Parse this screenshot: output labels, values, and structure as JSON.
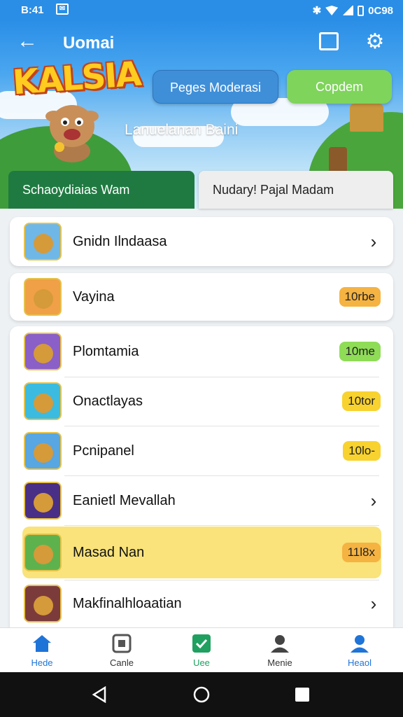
{
  "status_bar": {
    "time": "B:41",
    "mail_icon": "mail-icon",
    "battery": "0C98"
  },
  "app_bar": {
    "title": "Uomai"
  },
  "hero": {
    "logo_text": "KALSIA",
    "subtitle": "Lanuelanan Baini",
    "buttons": {
      "moderasi": "Peges Moderasi",
      "copy": "Copdem"
    },
    "colors": {
      "sky": "#2b8fe7",
      "grass": "#3f9c3a",
      "logo": "#ffcc1f"
    }
  },
  "tabs": {
    "left": "Schaoydiaias Wam",
    "right": "Nudary! Pajal Madam"
  },
  "items": [
    {
      "label": "Gnidn Ilndaasa",
      "trailing": "chevron",
      "thumb_color": "#6fb7e6"
    },
    {
      "label": "Vayina",
      "badge": "10rbe",
      "badge_color": "orange",
      "thumb_color": "#f0a046"
    },
    {
      "label": "Plomtamia",
      "badge": "10me",
      "badge_color": "green",
      "thumb_color": "#8a5fc7"
    },
    {
      "label": "Onactlayas",
      "badge": "10tor",
      "badge_color": "yellow",
      "thumb_color": "#3bbbe0"
    },
    {
      "label": "Pcnipanel",
      "badge": "10lo-",
      "badge_color": "yellow",
      "thumb_color": "#58a6e2"
    },
    {
      "label": "Eanietl Mevallah",
      "trailing": "chevron",
      "thumb_color": "#4a2f86"
    },
    {
      "label": "Masad Nan",
      "badge": "11l8x",
      "badge_color": "yellow",
      "highlighted": true,
      "thumb_color": "#5eb24d"
    },
    {
      "label": "Makfinalhloaatian",
      "trailing": "chevron",
      "thumb_color": "#7c3b3b"
    }
  ],
  "bottom_nav": [
    {
      "label": "Hede",
      "icon": "home-icon",
      "color": "#1f74d8"
    },
    {
      "label": "Canle",
      "icon": "game-icon",
      "color": "#555"
    },
    {
      "label": "Uee",
      "icon": "check-icon",
      "color": "#1fa060"
    },
    {
      "label": "Menie",
      "icon": "person-icon",
      "color": "#444"
    },
    {
      "label": "Heaol",
      "icon": "account-icon",
      "color": "#1f74d8"
    }
  ]
}
